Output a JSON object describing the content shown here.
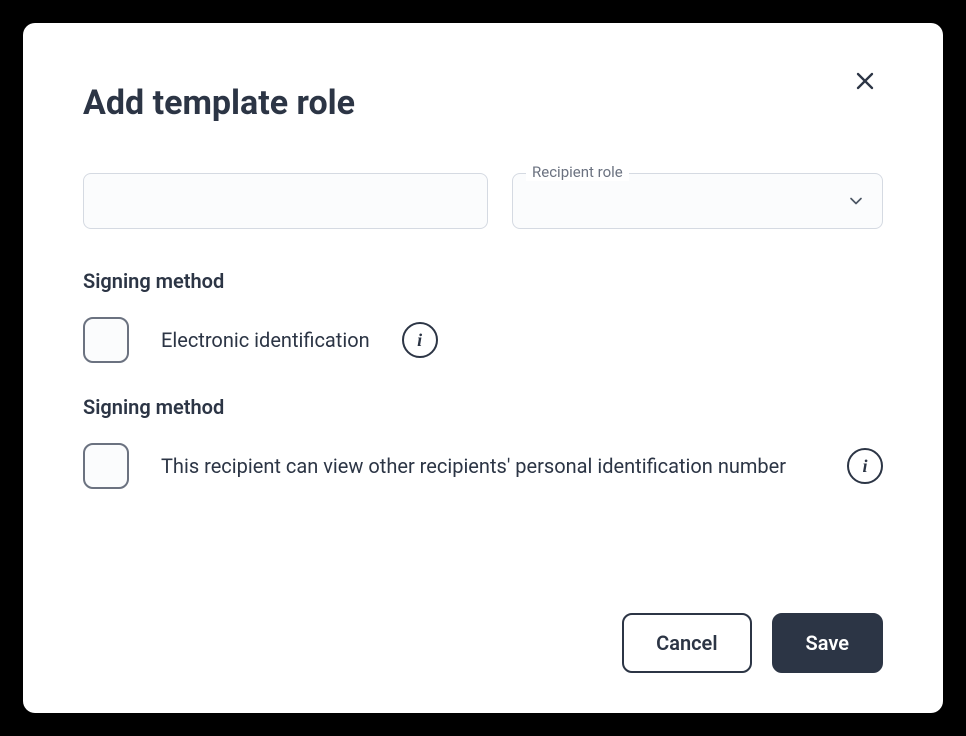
{
  "modal": {
    "title": "Add template role",
    "select_label": "Recipient role",
    "section1": {
      "title": "Signing method",
      "checkbox_label": "Electronic identification"
    },
    "section2": {
      "title": "Signing method",
      "checkbox_label": "This recipient can view other recipients' personal identification number"
    },
    "buttons": {
      "cancel": "Cancel",
      "save": "Save"
    }
  }
}
